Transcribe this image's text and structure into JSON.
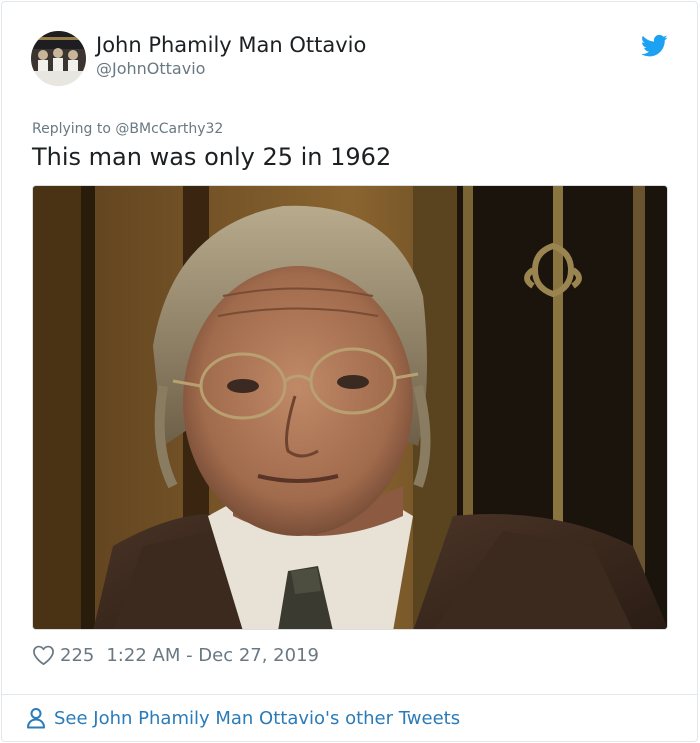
{
  "author": {
    "display_name": "John Phamily Man Ottavio",
    "handle": "@JohnOttavio"
  },
  "icons": {
    "brand": "twitter-bird-icon",
    "like": "heart-icon",
    "profile": "person-icon"
  },
  "reply_context": {
    "prefix": "Replying to ",
    "mention": "@BMcCarthy32"
  },
  "tweet": {
    "text": "This man was only 25 in 1962",
    "likes": "225",
    "timestamp": "1:22 AM - Dec 27, 2019"
  },
  "footer": {
    "link_text": "See John Phamily Man Ottavio's other Tweets"
  },
  "colors": {
    "twitter_blue": "#1da1f2",
    "link_blue": "#2b7bb9",
    "muted_gray": "#697882",
    "text_dark": "#1c2022",
    "border": "#e1e8ed"
  }
}
